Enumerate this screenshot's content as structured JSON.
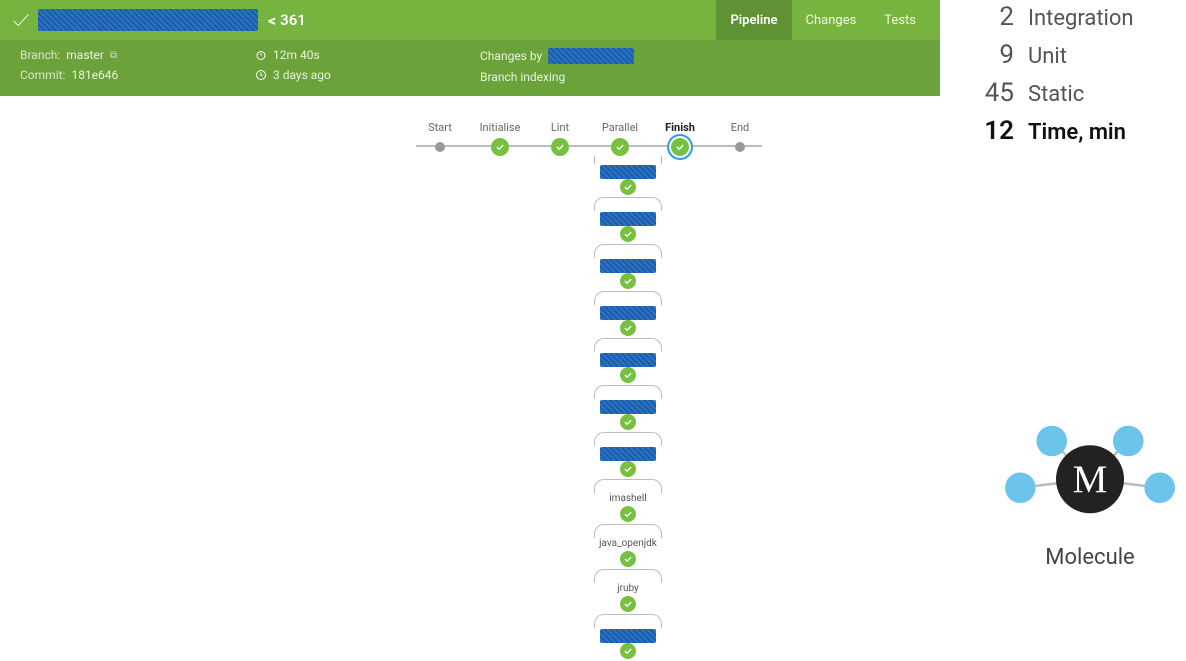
{
  "header": {
    "build_number": "361",
    "tabs": {
      "pipeline": "Pipeline",
      "changes": "Changes",
      "tests": "Tests"
    },
    "branch_label": "Branch:",
    "branch_value": "master",
    "commit_label": "Commit:",
    "commit_value": "181e646",
    "duration": "12m 40s",
    "age": "3 days ago",
    "changes_by_label": "Changes by",
    "branch_indexing": "Branch indexing"
  },
  "stages": {
    "start": "Start",
    "initialise": "Initialise",
    "lint": "Lint",
    "parallel": "Parallel",
    "finish": "Finish",
    "end": "End"
  },
  "parallel_items": [
    {
      "label": "",
      "redacted": true
    },
    {
      "label": "",
      "redacted": true
    },
    {
      "label": "",
      "redacted": true
    },
    {
      "label": "",
      "redacted": true
    },
    {
      "label": "",
      "redacted": true
    },
    {
      "label": "",
      "redacted": true
    },
    {
      "label": "",
      "redacted": true
    },
    {
      "label": "imashell",
      "redacted": false
    },
    {
      "label": "java_openjdk",
      "redacted": false
    },
    {
      "label": "jruby",
      "redacted": false
    },
    {
      "label": "",
      "redacted": true
    }
  ],
  "stats": [
    {
      "num": "2",
      "label": "Integration",
      "strong": false
    },
    {
      "num": "9",
      "label": "Unit",
      "strong": false
    },
    {
      "num": "45",
      "label": "Static",
      "strong": false
    },
    {
      "num": "12",
      "label": "Time, min",
      "strong": true
    }
  ],
  "molecule_label": "Molecule"
}
